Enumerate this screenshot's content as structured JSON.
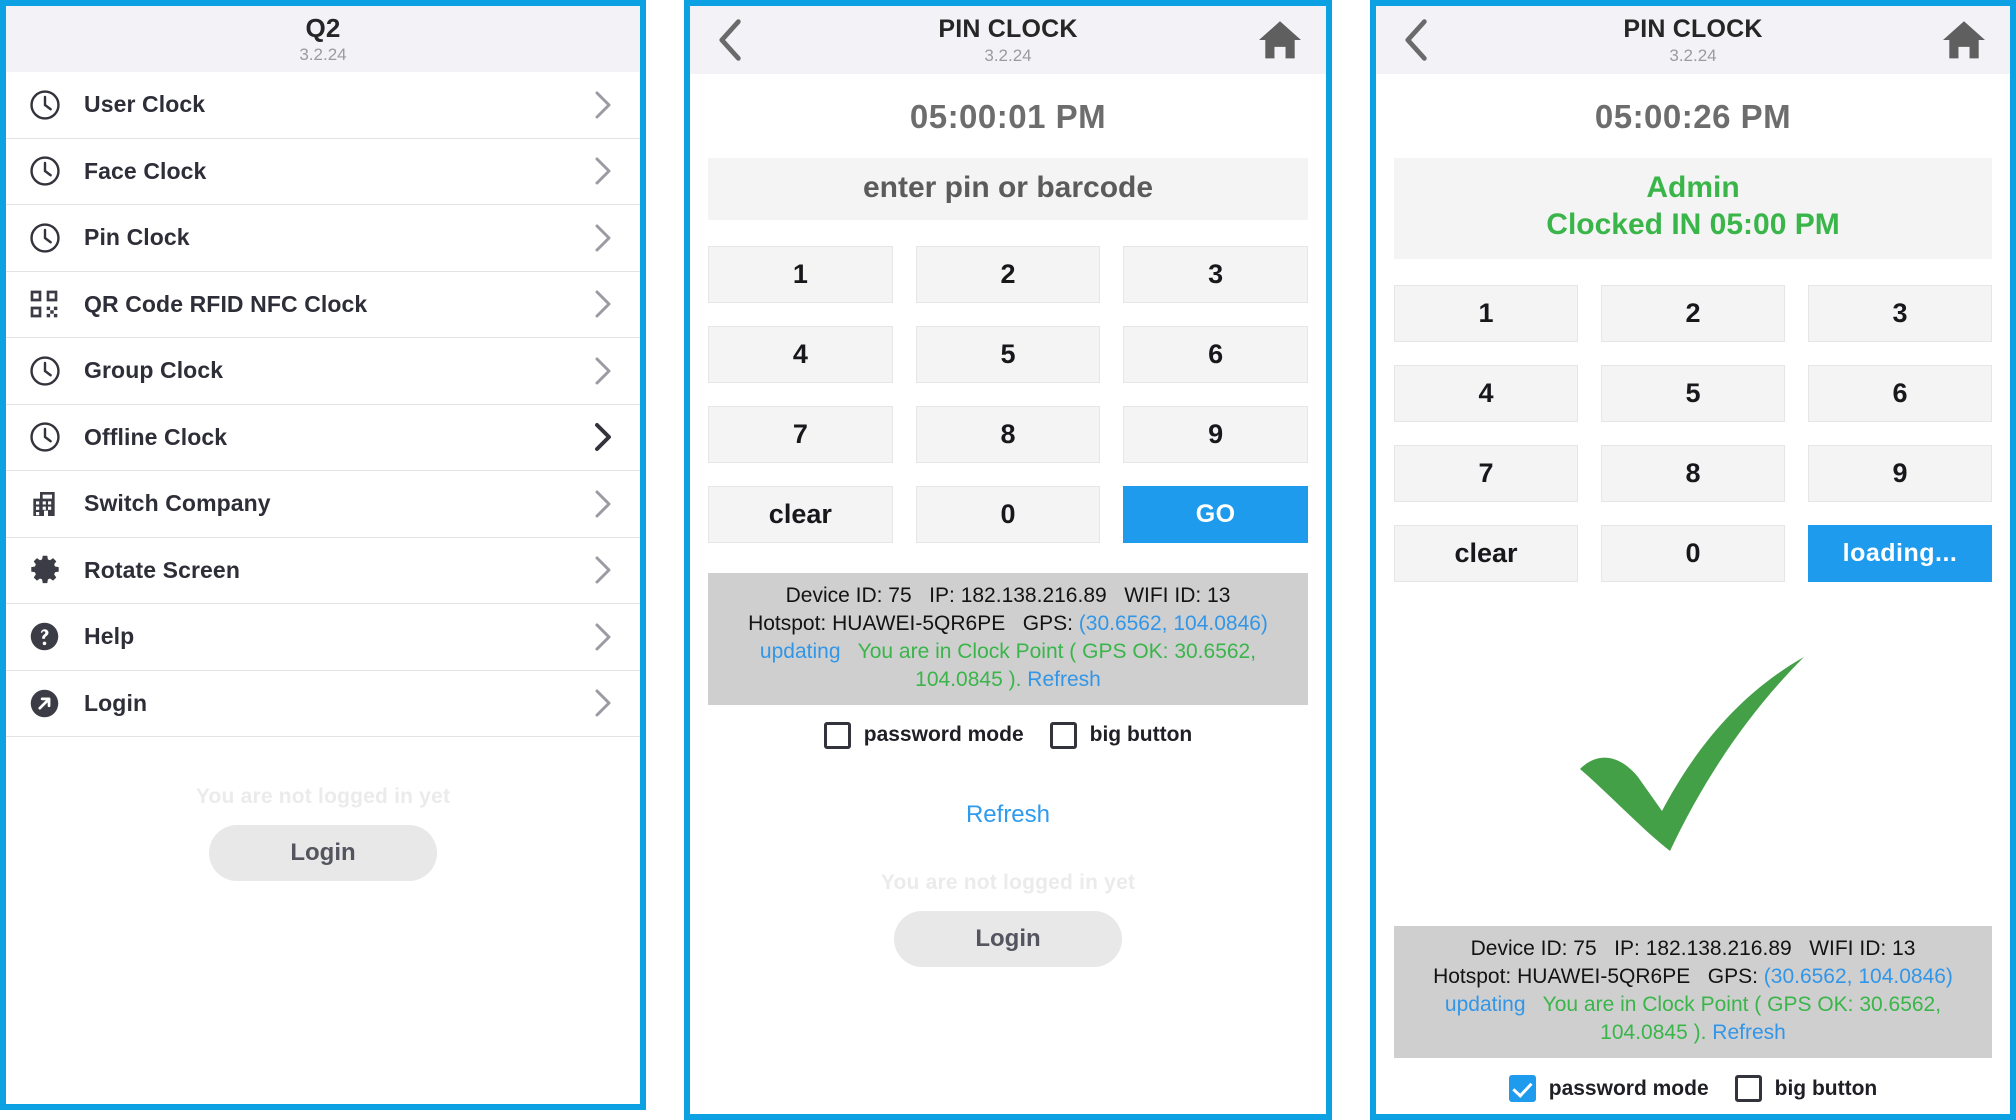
{
  "theme": {
    "accent": "#0BA1E2",
    "button_blue": "#1F9BEE",
    "success_green": "#3ab54a",
    "link_blue": "#3296e8",
    "info_bg": "#cfcfcf",
    "key_bg": "#f4f4f4"
  },
  "menu_panel": {
    "header": {
      "title": "Q2",
      "version": "3.2.24"
    },
    "items": [
      {
        "label": "User Clock",
        "icon": "clock-icon"
      },
      {
        "label": "Face Clock",
        "icon": "clock-icon"
      },
      {
        "label": "Pin Clock",
        "icon": "clock-icon"
      },
      {
        "label": "QR Code RFID NFC Clock",
        "icon": "qr-code-icon"
      },
      {
        "label": "Group Clock",
        "icon": "clock-icon"
      },
      {
        "label": "Offline Clock",
        "icon": "clock-icon"
      },
      {
        "label": "Switch Company",
        "icon": "building-icon"
      },
      {
        "label": "Rotate Screen",
        "icon": "gear-icon"
      },
      {
        "label": "Help",
        "icon": "question-circle-icon"
      },
      {
        "label": "Login",
        "icon": "arrow-out-circle-icon"
      }
    ],
    "footer": {
      "not_logged_in": "You are not logged in yet",
      "login_button": "Login"
    }
  },
  "pin_panel": {
    "header": {
      "title": "PIN CLOCK",
      "version": "3.2.24"
    },
    "time": "05:00:01 PM",
    "pin_placeholder": "enter pin or barcode",
    "keypad": [
      "1",
      "2",
      "3",
      "4",
      "5",
      "6",
      "7",
      "8",
      "9",
      "clear",
      "0",
      "GO"
    ],
    "device_info": {
      "device_id_label": "Device ID:",
      "device_id": "75",
      "ip_label": "IP:",
      "ip": "182.138.216.89",
      "wifi_label": "WIFI ID:",
      "wifi_id": "13",
      "hotspot_label": "Hotspot:",
      "hotspot": "HUAWEI-5QR6PE",
      "gps_label": "GPS:",
      "gps_coords": "(30.6562, 104.0846)",
      "updating": "updating",
      "clock_point": "You are in Clock Point ( GPS OK: 30.6562, 104.0845 ).",
      "refresh": "Refresh"
    },
    "options": [
      {
        "label": "password mode",
        "checked": false
      },
      {
        "label": "big button",
        "checked": false
      }
    ],
    "refresh_link": "Refresh",
    "footer": {
      "not_logged_in": "You are not logged in yet",
      "login_button": "Login"
    }
  },
  "result_panel": {
    "header": {
      "title": "PIN CLOCK",
      "version": "3.2.24"
    },
    "time": "05:00:26 PM",
    "status_name": "Admin",
    "status_text": "Clocked IN 05:00 PM",
    "keypad": [
      "1",
      "2",
      "3",
      "4",
      "5",
      "6",
      "7",
      "8",
      "9",
      "clear",
      "0",
      "loading..."
    ],
    "success_icon": "green-check-icon",
    "device_info": {
      "device_id_label": "Device ID:",
      "device_id": "75",
      "ip_label": "IP:",
      "ip": "182.138.216.89",
      "wifi_label": "WIFI ID:",
      "wifi_id": "13",
      "hotspot_label": "Hotspot:",
      "hotspot": "HUAWEI-5QR6PE",
      "gps_label": "GPS:",
      "gps_coords": "(30.6562, 104.0846)",
      "updating": "updating",
      "clock_point": "You are in Clock Point ( GPS OK: 30.6562, 104.0845 ).",
      "refresh": "Refresh"
    },
    "options": [
      {
        "label": "password mode",
        "checked": true
      },
      {
        "label": "big button",
        "checked": false
      }
    ]
  }
}
